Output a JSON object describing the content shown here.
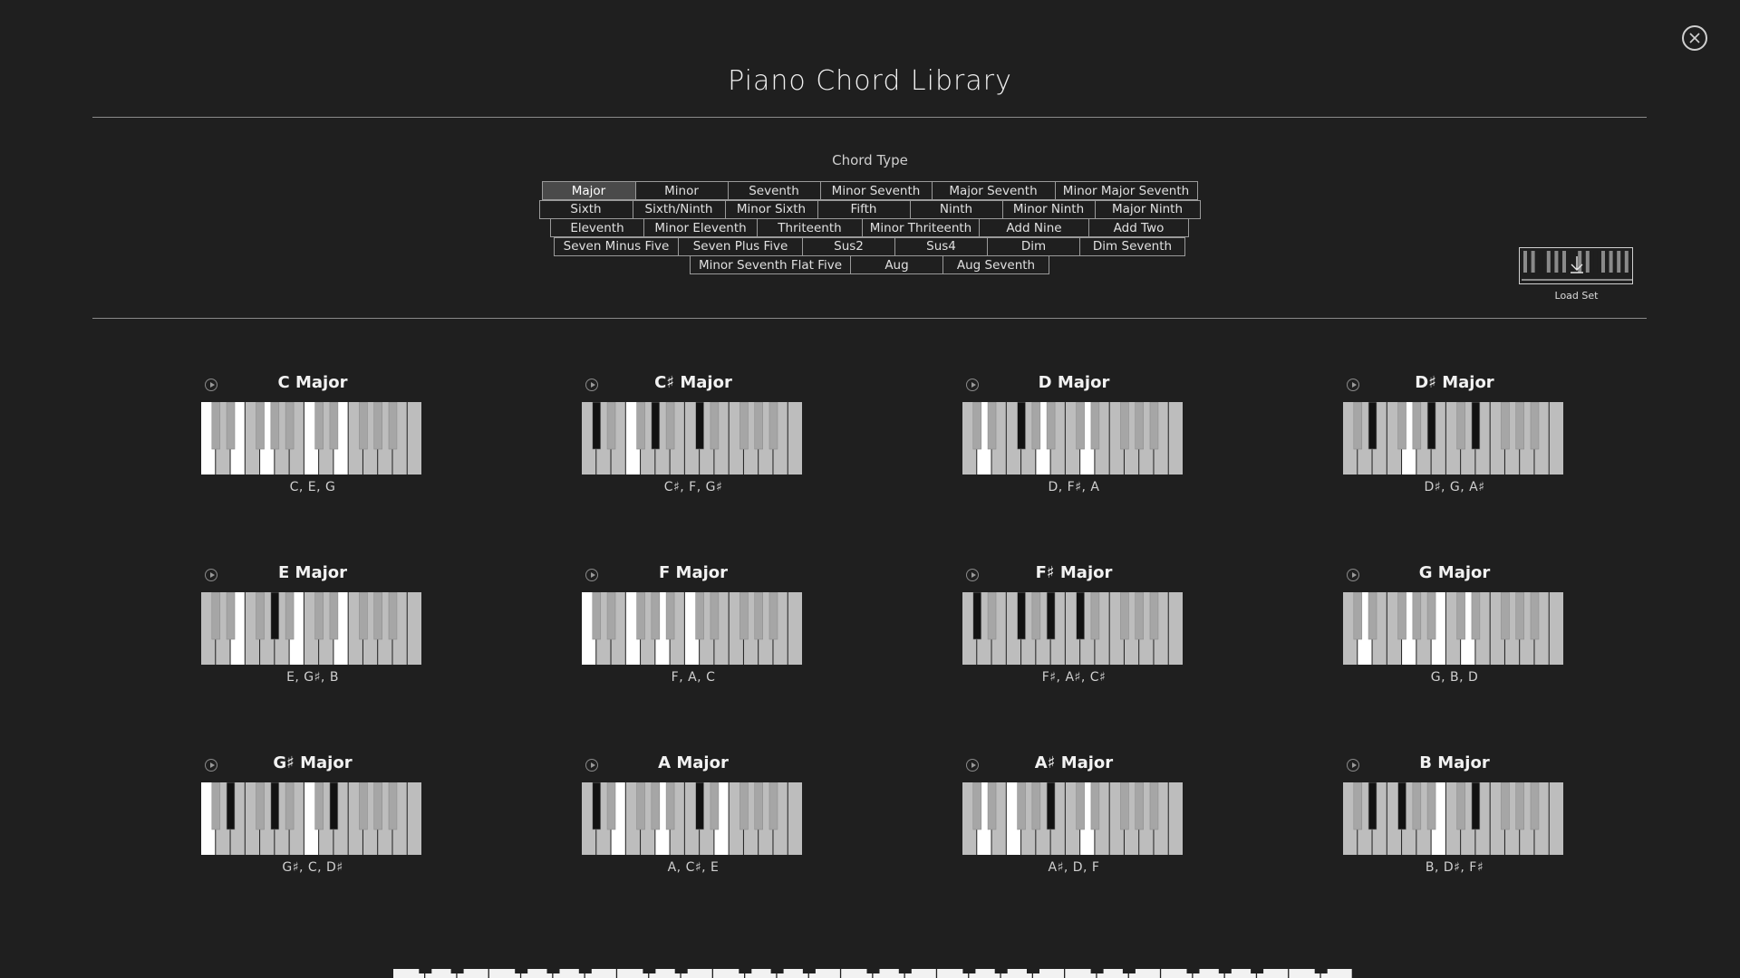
{
  "page": {
    "title": "Piano Chord Library"
  },
  "chord_type": {
    "label": "Chord Type",
    "selected": "Major",
    "rows": [
      [
        "Major",
        "Minor",
        "Seventh",
        "Minor Seventh",
        "Major Seventh",
        "Minor Major Seventh"
      ],
      [
        "Sixth",
        "Sixth/Ninth",
        "Minor Sixth",
        "Fifth",
        "Ninth",
        "Minor Ninth",
        "Major Ninth"
      ],
      [
        "Eleventh",
        "Minor Eleventh",
        "Thriteenth",
        "Minor Thriteenth",
        "Add Nine",
        "Add Two"
      ],
      [
        "Seven Minus Five",
        "Seven Plus Five",
        "Sus2",
        "Sus4",
        "Dim",
        "Dim Seventh"
      ],
      [
        "Minor Seventh Flat Five",
        "Aug",
        "Aug Seventh"
      ]
    ]
  },
  "load_set": {
    "label": "Load Set"
  },
  "chords": [
    {
      "name": "C Major",
      "notes": "C, E, G"
    },
    {
      "name": "C♯ Major",
      "notes": "C♯, F, G♯"
    },
    {
      "name": "D Major",
      "notes": "D, F♯, A"
    },
    {
      "name": "D♯ Major",
      "notes": "D♯, G, A♯"
    },
    {
      "name": "E Major",
      "notes": "E, G♯, B"
    },
    {
      "name": "F Major",
      "notes": "F, A, C"
    },
    {
      "name": "F♯ Major",
      "notes": "F♯, A♯, C♯"
    },
    {
      "name": "G Major",
      "notes": "G, B, D"
    },
    {
      "name": "G♯ Major",
      "notes": "G♯, C, D♯"
    },
    {
      "name": "A Major",
      "notes": "A, C♯, E"
    },
    {
      "name": "A♯ Major",
      "notes": "A♯, D, F"
    },
    {
      "name": "B Major",
      "notes": "B, D♯, F♯"
    }
  ],
  "colors": {
    "background": "#1f1f1f",
    "key_white": "#bdbdbd",
    "key_white_highlight": "#ffffff",
    "key_black": "#a6a6a6",
    "key_black_highlight": "#121212",
    "accent_marks": [
      "#d8b24a",
      "#7b6fd0",
      "#d05a6a"
    ]
  },
  "icons": {
    "close": "close-icon",
    "play": "play-icon",
    "load_set": "keyboard-download-icon"
  }
}
